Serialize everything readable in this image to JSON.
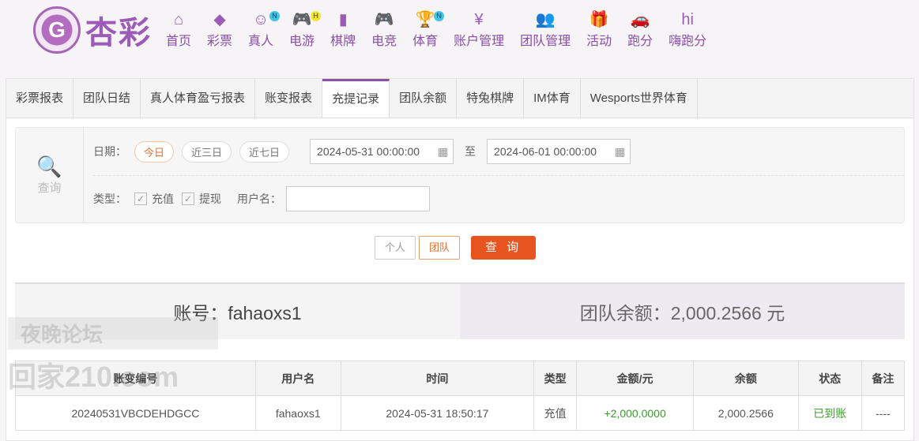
{
  "brand": {
    "name": "杏彩"
  },
  "nav": [
    {
      "label": "首页",
      "icon": "home-icon",
      "glyph": "⌂"
    },
    {
      "label": "彩票",
      "icon": "ticket-icon",
      "glyph": "◆"
    },
    {
      "label": "真人",
      "icon": "dealer-icon",
      "glyph": "☺",
      "badge": "N",
      "badge_color": "#3fc3e8"
    },
    {
      "label": "电游",
      "icon": "gamepad-icon",
      "glyph": "🎮",
      "badge": "H",
      "badge_color": "#f5e535"
    },
    {
      "label": "棋牌",
      "icon": "cards-icon",
      "glyph": "▮"
    },
    {
      "label": "电竞",
      "icon": "gamepad-icon",
      "glyph": "🎮"
    },
    {
      "label": "体育",
      "icon": "trophy-icon",
      "glyph": "🏆",
      "badge": "N",
      "badge_color": "#3fc3e8"
    },
    {
      "label": "账户管理",
      "icon": "yen-icon",
      "glyph": "¥"
    },
    {
      "label": "团队管理",
      "icon": "team-icon",
      "glyph": "👥"
    },
    {
      "label": "活动",
      "icon": "gift-icon",
      "glyph": "🎁"
    },
    {
      "label": "跑分",
      "icon": "car-icon",
      "glyph": "🚗"
    },
    {
      "label": "嗨跑分",
      "icon": "hi-icon",
      "glyph": "hi"
    }
  ],
  "tabs": [
    "彩票报表",
    "团队日结",
    "真人体育盈亏报表",
    "账变报表",
    "充提记录",
    "团队余额",
    "特兔棋牌",
    "IM体育",
    "Wesports世界体育"
  ],
  "active_tab": 4,
  "filter": {
    "query_label": "查询",
    "date_label": "日期：",
    "date_options": [
      "今日",
      "近三日",
      "近七日"
    ],
    "start": "2024-05-31 00:00:00",
    "to": "至",
    "end": "2024-06-01 00:00:00",
    "type_label": "类型：",
    "types": [
      "充值",
      "提现"
    ],
    "username_label": "用户名：",
    "username_value": ""
  },
  "buttons": {
    "personal": "个人",
    "team": "团队",
    "query": "查 询"
  },
  "summary": {
    "account": "账号：fahaoxs1",
    "balance": "团队余额：2,000.2566 元"
  },
  "table": {
    "headers": [
      "账变编号",
      "用户名",
      "时间",
      "类型",
      "金额/元",
      "余额",
      "状态",
      "备注"
    ],
    "rows": [
      [
        "20240531VBCDEHDGCC",
        "fahaoxs1",
        "2024-05-31 18:50:17",
        "充值",
        "+2,000.0000",
        "2,000.2566",
        "已到账",
        "----"
      ]
    ]
  },
  "watermark": {
    "line1": "夜晚论坛",
    "line2": "回家210.com"
  }
}
